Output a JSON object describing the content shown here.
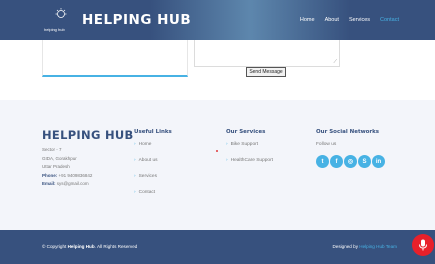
{
  "brand": {
    "name": "HELPING HUB",
    "small": "helping hub"
  },
  "nav": {
    "items": [
      "Home",
      "About",
      "Services",
      "Contact"
    ],
    "active_index": 3
  },
  "form": {
    "send_label": "Send Message"
  },
  "footer": {
    "col1": {
      "title": "HELPING HUB",
      "lines": [
        "Sector - 7",
        "GIDA, Gorakhpur",
        "Uttar Pradesh"
      ],
      "phone_label": "Phone:",
      "phone": "+91 9409836842",
      "email_label": "Email:",
      "email": "sys@gmail.com"
    },
    "useful_links": {
      "title": "Useful Links",
      "items": [
        "Home",
        "About us",
        "Services",
        "Contact"
      ]
    },
    "our_services": {
      "title": "Our Services",
      "items": [
        "Bike Support",
        "HealthCare Support"
      ]
    },
    "social": {
      "title": "Our Social Networks",
      "follow": "Follow us",
      "icons": [
        "twitter-icon",
        "facebook-icon",
        "instagram-icon",
        "skype-icon",
        "linkedin-icon"
      ]
    }
  },
  "bottom": {
    "copyright_prefix": "© Copyright",
    "copyright_brand": "Helping Hub",
    "copyright_suffix": ". All Rights Reserved",
    "designed_prefix": "Designed by",
    "designed_brand": "Helping Hub Team"
  },
  "colors": {
    "navy": "#37517e",
    "accent": "#47b2e4",
    "mic": "#e8202a"
  }
}
